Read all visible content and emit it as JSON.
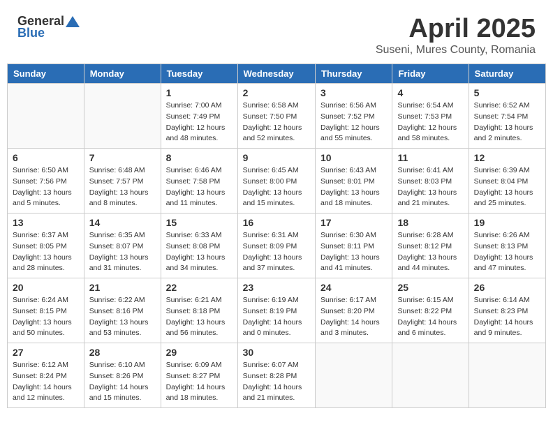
{
  "logo": {
    "general": "General",
    "blue": "Blue"
  },
  "title": {
    "month": "April 2025",
    "location": "Suseni, Mures County, Romania"
  },
  "weekdays": [
    "Sunday",
    "Monday",
    "Tuesday",
    "Wednesday",
    "Thursday",
    "Friday",
    "Saturday"
  ],
  "weeks": [
    [
      {
        "day": "",
        "info": ""
      },
      {
        "day": "",
        "info": ""
      },
      {
        "day": "1",
        "info": "Sunrise: 7:00 AM\nSunset: 7:49 PM\nDaylight: 12 hours\nand 48 minutes."
      },
      {
        "day": "2",
        "info": "Sunrise: 6:58 AM\nSunset: 7:50 PM\nDaylight: 12 hours\nand 52 minutes."
      },
      {
        "day": "3",
        "info": "Sunrise: 6:56 AM\nSunset: 7:52 PM\nDaylight: 12 hours\nand 55 minutes."
      },
      {
        "day": "4",
        "info": "Sunrise: 6:54 AM\nSunset: 7:53 PM\nDaylight: 12 hours\nand 58 minutes."
      },
      {
        "day": "5",
        "info": "Sunrise: 6:52 AM\nSunset: 7:54 PM\nDaylight: 13 hours\nand 2 minutes."
      }
    ],
    [
      {
        "day": "6",
        "info": "Sunrise: 6:50 AM\nSunset: 7:56 PM\nDaylight: 13 hours\nand 5 minutes."
      },
      {
        "day": "7",
        "info": "Sunrise: 6:48 AM\nSunset: 7:57 PM\nDaylight: 13 hours\nand 8 minutes."
      },
      {
        "day": "8",
        "info": "Sunrise: 6:46 AM\nSunset: 7:58 PM\nDaylight: 13 hours\nand 11 minutes."
      },
      {
        "day": "9",
        "info": "Sunrise: 6:45 AM\nSunset: 8:00 PM\nDaylight: 13 hours\nand 15 minutes."
      },
      {
        "day": "10",
        "info": "Sunrise: 6:43 AM\nSunset: 8:01 PM\nDaylight: 13 hours\nand 18 minutes."
      },
      {
        "day": "11",
        "info": "Sunrise: 6:41 AM\nSunset: 8:03 PM\nDaylight: 13 hours\nand 21 minutes."
      },
      {
        "day": "12",
        "info": "Sunrise: 6:39 AM\nSunset: 8:04 PM\nDaylight: 13 hours\nand 25 minutes."
      }
    ],
    [
      {
        "day": "13",
        "info": "Sunrise: 6:37 AM\nSunset: 8:05 PM\nDaylight: 13 hours\nand 28 minutes."
      },
      {
        "day": "14",
        "info": "Sunrise: 6:35 AM\nSunset: 8:07 PM\nDaylight: 13 hours\nand 31 minutes."
      },
      {
        "day": "15",
        "info": "Sunrise: 6:33 AM\nSunset: 8:08 PM\nDaylight: 13 hours\nand 34 minutes."
      },
      {
        "day": "16",
        "info": "Sunrise: 6:31 AM\nSunset: 8:09 PM\nDaylight: 13 hours\nand 37 minutes."
      },
      {
        "day": "17",
        "info": "Sunrise: 6:30 AM\nSunset: 8:11 PM\nDaylight: 13 hours\nand 41 minutes."
      },
      {
        "day": "18",
        "info": "Sunrise: 6:28 AM\nSunset: 8:12 PM\nDaylight: 13 hours\nand 44 minutes."
      },
      {
        "day": "19",
        "info": "Sunrise: 6:26 AM\nSunset: 8:13 PM\nDaylight: 13 hours\nand 47 minutes."
      }
    ],
    [
      {
        "day": "20",
        "info": "Sunrise: 6:24 AM\nSunset: 8:15 PM\nDaylight: 13 hours\nand 50 minutes."
      },
      {
        "day": "21",
        "info": "Sunrise: 6:22 AM\nSunset: 8:16 PM\nDaylight: 13 hours\nand 53 minutes."
      },
      {
        "day": "22",
        "info": "Sunrise: 6:21 AM\nSunset: 8:18 PM\nDaylight: 13 hours\nand 56 minutes."
      },
      {
        "day": "23",
        "info": "Sunrise: 6:19 AM\nSunset: 8:19 PM\nDaylight: 14 hours\nand 0 minutes."
      },
      {
        "day": "24",
        "info": "Sunrise: 6:17 AM\nSunset: 8:20 PM\nDaylight: 14 hours\nand 3 minutes."
      },
      {
        "day": "25",
        "info": "Sunrise: 6:15 AM\nSunset: 8:22 PM\nDaylight: 14 hours\nand 6 minutes."
      },
      {
        "day": "26",
        "info": "Sunrise: 6:14 AM\nSunset: 8:23 PM\nDaylight: 14 hours\nand 9 minutes."
      }
    ],
    [
      {
        "day": "27",
        "info": "Sunrise: 6:12 AM\nSunset: 8:24 PM\nDaylight: 14 hours\nand 12 minutes."
      },
      {
        "day": "28",
        "info": "Sunrise: 6:10 AM\nSunset: 8:26 PM\nDaylight: 14 hours\nand 15 minutes."
      },
      {
        "day": "29",
        "info": "Sunrise: 6:09 AM\nSunset: 8:27 PM\nDaylight: 14 hours\nand 18 minutes."
      },
      {
        "day": "30",
        "info": "Sunrise: 6:07 AM\nSunset: 8:28 PM\nDaylight: 14 hours\nand 21 minutes."
      },
      {
        "day": "",
        "info": ""
      },
      {
        "day": "",
        "info": ""
      },
      {
        "day": "",
        "info": ""
      }
    ]
  ]
}
